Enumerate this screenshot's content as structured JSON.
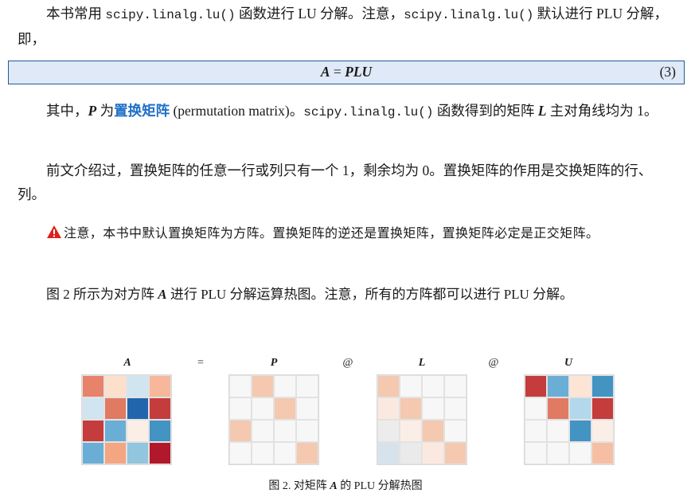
{
  "para1": {
    "t1": "本书常用 ",
    "code1": "scipy.linalg.lu()",
    "t2": " 函数进行 LU 分解。注意，",
    "code2": "scipy.linalg.lu()",
    "t3": " 默认进行 PLU 分解，即，"
  },
  "equation": {
    "A": "A",
    "eq": " = ",
    "PLU": "PLU",
    "number": "(3)"
  },
  "para2": {
    "t1": "其中，",
    "P": "P",
    "t2": " 为",
    "link": "置换矩阵",
    "t3": " (permutation matrix)。",
    "code": "scipy.linalg.lu()",
    "t4": " 函数得到的矩阵 ",
    "L": "L",
    "t5": " 主对角线均为 1。"
  },
  "para3": "前文介绍过，置换矩阵的任意一行或列只有一个 1，剩余均为 0。置换矩阵的作用是交换矩阵的行、列。",
  "note": {
    "icon": "warning-triangle-icon",
    "icon_color": "#e0201b",
    "text": "注意，本书中默认置换矩阵为方阵。置换矩阵的逆还是置换矩阵，置换矩阵必定是正交矩阵。"
  },
  "para4": {
    "t1": "图 2 所示为对方阵 ",
    "A": "A",
    "t2": " 进行 PLU 分解运算热图。注意，所有的方阵都可以进行 PLU 分解。"
  },
  "figure": {
    "operators": [
      "=",
      "@",
      "@"
    ],
    "matrices": [
      {
        "label": "A",
        "colors": [
          [
            "#e8826a",
            "#fde0cc",
            "#d1e5f0",
            "#f6b79a"
          ],
          [
            "#d1e5f0",
            "#e17a62",
            "#2166ac",
            "#c43c3c"
          ],
          [
            "#c43c3c",
            "#6aaed6",
            "#fbeee6",
            "#4393c3"
          ],
          [
            "#6aaed6",
            "#f4a582",
            "#92c5de",
            "#b2182b"
          ]
        ]
      },
      {
        "label": "P",
        "colors": [
          [
            "#f7f7f7",
            "#f4c9b0",
            "#f7f7f7",
            "#f7f7f7"
          ],
          [
            "#f7f7f7",
            "#f7f7f7",
            "#f4c9b0",
            "#f7f7f7"
          ],
          [
            "#f4c9b0",
            "#f7f7f7",
            "#f7f7f7",
            "#f7f7f7"
          ],
          [
            "#f7f7f7",
            "#f7f7f7",
            "#f7f7f7",
            "#f4c9b0"
          ]
        ]
      },
      {
        "label": "L",
        "colors": [
          [
            "#f4c9b0",
            "#f7f7f7",
            "#f7f7f7",
            "#f7f7f7"
          ],
          [
            "#fbe9e0",
            "#f4c9b0",
            "#f7f7f7",
            "#f7f7f7"
          ],
          [
            "#ececec",
            "#fbeee6",
            "#f4c9b0",
            "#f7f7f7"
          ],
          [
            "#d6e3ec",
            "#eaeaea",
            "#fbe9e0",
            "#f4c9b0"
          ]
        ]
      },
      {
        "label": "U",
        "colors": [
          [
            "#c43c3c",
            "#6aaed6",
            "#fde5d6",
            "#4393c3"
          ],
          [
            "#f7f7f7",
            "#e17a62",
            "#b3d7eb",
            "#c43c3c"
          ],
          [
            "#f7f7f7",
            "#f7f7f7",
            "#4393c3",
            "#fbeee6"
          ],
          [
            "#f7f7f7",
            "#f7f7f7",
            "#f7f7f7",
            "#f6bfa3"
          ]
        ]
      }
    ],
    "caption": {
      "t1": "图 2. 对矩阵 ",
      "A": "A",
      "t2": " 的 PLU 分解热图"
    }
  }
}
